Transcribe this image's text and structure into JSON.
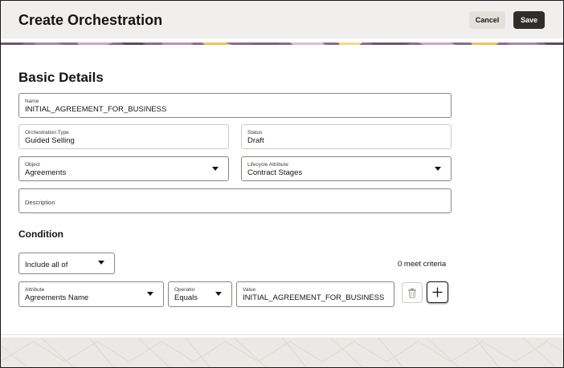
{
  "header": {
    "title": "Create Orchestration",
    "cancel_label": "Cancel",
    "save_label": "Save"
  },
  "basic_details": {
    "title": "Basic Details",
    "name": {
      "label": "Name",
      "value": "INITIAL_AGREEMENT_FOR_BUSINESS"
    },
    "orchestration_type": {
      "label": "Orchestration Type",
      "value": "Guided Selling"
    },
    "status": {
      "label": "Status",
      "value": "Draft"
    },
    "object": {
      "label": "Object",
      "value": "Agreements"
    },
    "lifecycle_attribute": {
      "label": "Lifecycle Attribute",
      "value": "Contract Stages"
    },
    "description": {
      "label": "Description",
      "value": ""
    }
  },
  "condition": {
    "title": "Condition",
    "match_mode": "Include all of",
    "meet_criteria": "0 meet criteria",
    "row": {
      "attribute": {
        "label": "Attribute",
        "value": "Agreements Name"
      },
      "operator": {
        "label": "Operator",
        "value": "Equals"
      },
      "value": {
        "label": "Value",
        "value": "INITIAL_AGREEMENT_FOR_BUSINESS"
      }
    }
  },
  "icons": {
    "delete": "trash-icon",
    "add": "plus-icon",
    "dropdown": "caret-down-icon"
  },
  "colors": {
    "header_bg": "#f1efed",
    "save_bg": "#312d2a",
    "banner_purple": "#8a6d8e",
    "banner_yellow": "#e7c36b"
  }
}
